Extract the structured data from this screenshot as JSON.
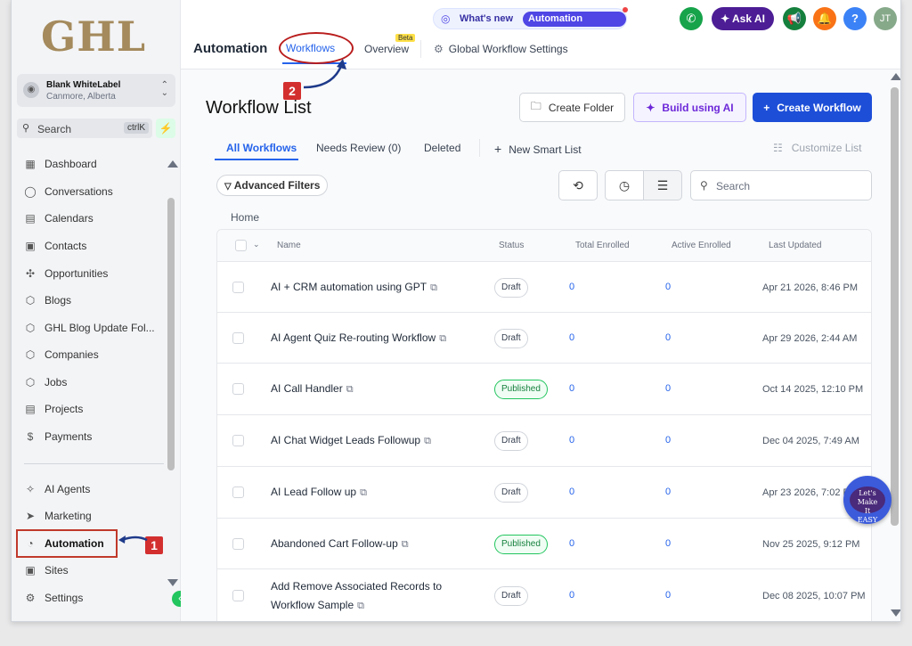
{
  "sidebar": {
    "logo": "GHL",
    "account": {
      "name": "Blank WhiteLabel",
      "location": "Canmore, Alberta"
    },
    "search": {
      "label": "Search",
      "shortcut": "ctrlK"
    },
    "items": [
      {
        "label": "Dashboard",
        "icon": "dashboard-icon",
        "glyph": "▦"
      },
      {
        "label": "Conversations",
        "icon": "chat-icon",
        "glyph": "◯"
      },
      {
        "label": "Calendars",
        "icon": "calendar-icon",
        "glyph": "▤"
      },
      {
        "label": "Contacts",
        "icon": "contacts-icon",
        "glyph": "▣"
      },
      {
        "label": "Opportunities",
        "icon": "opportunities-icon",
        "glyph": "✣"
      },
      {
        "label": "Blogs",
        "icon": "blogs-icon",
        "glyph": "⬡"
      },
      {
        "label": "GHL Blog Update Fol...",
        "icon": "folder-icon",
        "glyph": "⬡"
      },
      {
        "label": "Companies",
        "icon": "companies-icon",
        "glyph": "⬡"
      },
      {
        "label": "Jobs",
        "icon": "jobs-icon",
        "glyph": "⬡"
      },
      {
        "label": "Projects",
        "icon": "projects-icon",
        "glyph": "▤"
      },
      {
        "label": "Payments",
        "icon": "payments-icon",
        "glyph": "$"
      },
      {
        "label": "AI Agents",
        "icon": "ai-agents-icon",
        "glyph": "✧"
      },
      {
        "label": "Marketing",
        "icon": "marketing-icon",
        "glyph": "➤"
      },
      {
        "label": "Automation",
        "icon": "automation-icon",
        "glyph": "◔"
      },
      {
        "label": "Sites",
        "icon": "sites-icon",
        "glyph": "▣"
      },
      {
        "label": "Settings",
        "icon": "settings-icon",
        "glyph": "⚙"
      }
    ]
  },
  "header": {
    "whats_new": "What's new",
    "updates_pill": "Automation Updates",
    "ask_ai": "Ask AI",
    "avatar": "JT",
    "page_title": "Automation",
    "tabs": {
      "workflows": "Workflows",
      "overview": "Overview",
      "beta": "Beta",
      "global": "Global Workflow Settings"
    }
  },
  "annotations": {
    "one": "1",
    "two": "2"
  },
  "main": {
    "title": "Workflow List",
    "buttons": {
      "folder": "Create Folder",
      "ai": "Build using AI",
      "create": "Create Workflow"
    },
    "subtabs": {
      "all": "All Workflows",
      "review": "Needs Review (0)",
      "deleted": "Deleted",
      "smart": "New Smart List",
      "customize": "Customize List"
    },
    "advanced_filters": "Advanced Filters",
    "search_placeholder": "Search",
    "breadcrumb": "Home",
    "columns": {
      "name": "Name",
      "status": "Status",
      "total": "Total Enrolled",
      "active": "Active Enrolled",
      "updated": "Last Updated"
    },
    "rows": [
      {
        "name": "AI + CRM automation using GPT",
        "status": "Draft",
        "total": "0",
        "active": "0",
        "updated": "Apr 21 2026, 8:46 PM"
      },
      {
        "name": "AI Agent Quiz Re-routing Workflow",
        "status": "Draft",
        "total": "0",
        "active": "0",
        "updated": "Apr 29 2026, 2:44 AM"
      },
      {
        "name": "AI Call Handler",
        "status": "Published",
        "total": "0",
        "active": "0",
        "updated": "Oct 14 2025, 12:10 PM"
      },
      {
        "name": "AI Chat Widget Leads Followup",
        "status": "Draft",
        "total": "0",
        "active": "0",
        "updated": "Dec 04 2025, 7:49 AM"
      },
      {
        "name": "AI Lead Follow up",
        "status": "Draft",
        "total": "0",
        "active": "0",
        "updated": "Apr 23 2026, 7:02 PM"
      },
      {
        "name": "Abandoned Cart Follow-up",
        "status": "Published",
        "total": "0",
        "active": "0",
        "updated": "Nov 25 2025, 9:12 PM"
      },
      {
        "name": "Add Remove Associated Records to Workflow Sample",
        "status": "Draft",
        "total": "0",
        "active": "0",
        "updated": "Dec 08 2025, 10:07 PM"
      }
    ]
  },
  "badge": {
    "line1": "Let's Make",
    "line2": "It",
    "line3": "EASY"
  },
  "colors": {
    "accent": "#2563eb",
    "published": "#22c55e",
    "annotation": "#c0392b"
  }
}
